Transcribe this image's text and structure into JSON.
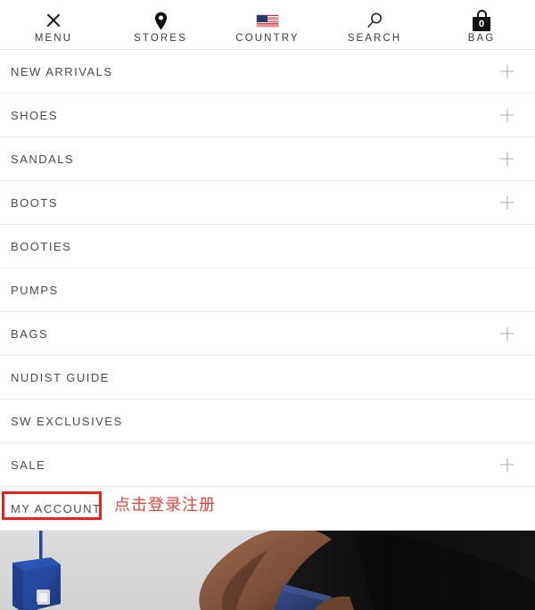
{
  "header": {
    "items": [
      {
        "label": "MENU",
        "icon": "close-x-icon",
        "badge": null
      },
      {
        "label": "STORES",
        "icon": "map-pin-icon",
        "badge": null
      },
      {
        "label": "COUNTRY",
        "icon": "us-flag-icon",
        "badge": null
      },
      {
        "label": "SEARCH",
        "icon": "magnifier-icon",
        "badge": null
      },
      {
        "label": "BAG",
        "icon": "shopping-bag-icon",
        "badge": "0"
      }
    ]
  },
  "menu": {
    "items": [
      {
        "label": "NEW ARRIVALS",
        "expandable": true
      },
      {
        "label": "SHOES",
        "expandable": true
      },
      {
        "label": "SANDALS",
        "expandable": true
      },
      {
        "label": "BOOTS",
        "expandable": true
      },
      {
        "label": "BOOTIES",
        "expandable": false
      },
      {
        "label": "PUMPS",
        "expandable": false
      },
      {
        "label": "BAGS",
        "expandable": true
      },
      {
        "label": "NUDIST GUIDE",
        "expandable": false
      },
      {
        "label": "SW EXCLUSIVES",
        "expandable": false
      },
      {
        "label": "SALE",
        "expandable": true
      },
      {
        "label": "MY ACCOUNT",
        "expandable": false
      }
    ]
  },
  "annotation": {
    "text": "点击登录注册",
    "target_label": "MY ACCOUNT",
    "box_color": "#e8221f",
    "text_color": "#e8443f"
  },
  "hero": {
    "alt": "Model in black dress holding a royal blue handbag",
    "background_color": "#d9d9d9",
    "bag_color": "#24469b",
    "garment_color": "#111111",
    "cuff_color": "#2c3f73",
    "skin_color": "#8a5a44"
  },
  "colors": {
    "text": "#4b4b4b",
    "header_text": "#3a3a3a",
    "divider": "#ededed",
    "plus": "#a9a9a9",
    "background": "#ffffff"
  }
}
